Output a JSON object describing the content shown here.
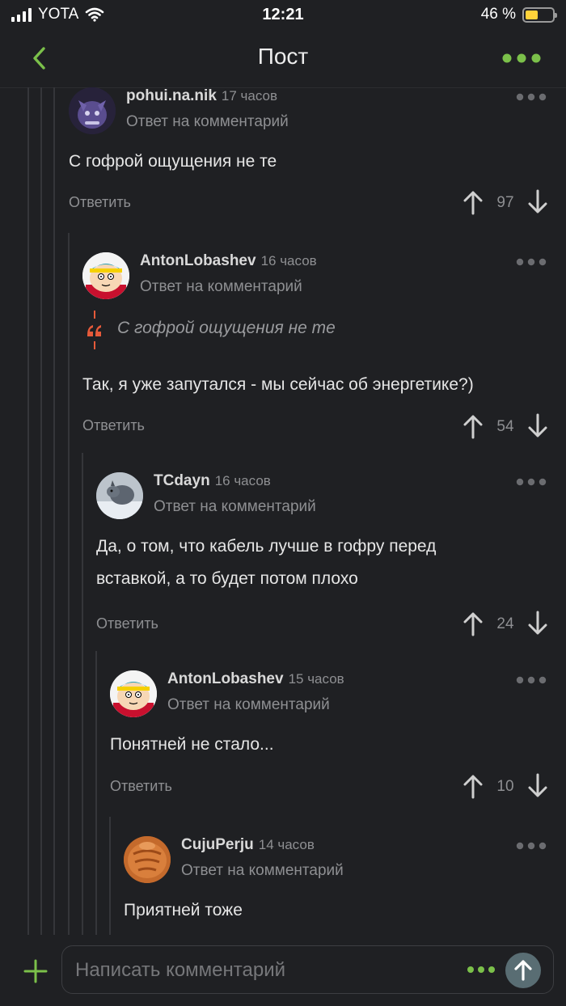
{
  "status_bar": {
    "carrier": "YOTA",
    "time": "12:21",
    "battery_percent": "46 %",
    "battery_level": 0.46
  },
  "nav": {
    "title": "Пост"
  },
  "colors": {
    "accent": "#7bc04a",
    "background": "#1f2023",
    "battery": "#ffd23a"
  },
  "comments": [
    {
      "user": "pohui.na.nik",
      "time": "17 часов",
      "subtitle": "Ответ на комментарий",
      "lines": [
        "С гофрой ощущения не те"
      ],
      "reply": "Ответить",
      "score": "97"
    },
    {
      "user": "AntonLobashev",
      "time": "16 часов",
      "subtitle": "Ответ на комментарий",
      "quote": "С гофрой ощущения не те",
      "lines": [
        "Так, я уже запутался - мы сейчас об энергетике?)"
      ],
      "reply": "Ответить",
      "score": "54"
    },
    {
      "user": "TCdayn",
      "time": "16 часов",
      "subtitle": "Ответ на комментарий",
      "lines": [
        "Да, о том, что кабель лучше в гофру перед",
        "вставкой, а то будет потом плохо"
      ],
      "reply": "Ответить",
      "score": "24"
    },
    {
      "user": "AntonLobashev",
      "time": "15 часов",
      "subtitle": "Ответ на комментарий",
      "lines": [
        "Понятней не стало..."
      ],
      "reply": "Ответить",
      "score": "10"
    },
    {
      "user": "CujuPerju",
      "time": "14 часов",
      "subtitle": "Ответ на комментарий",
      "lines": [
        "Приятней тоже"
      ]
    }
  ],
  "composer": {
    "placeholder": "Написать комментарий"
  }
}
